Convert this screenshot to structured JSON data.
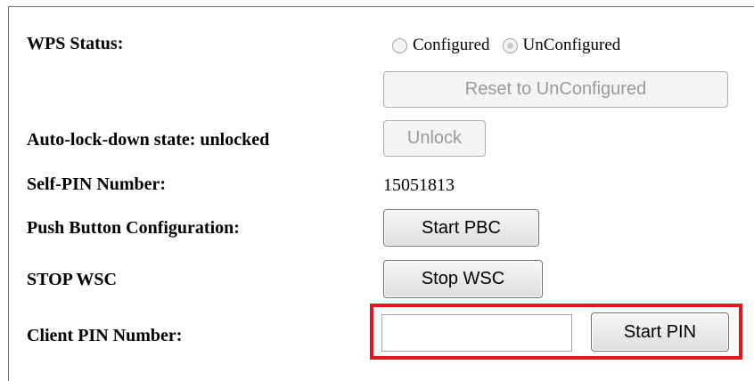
{
  "wps_status": {
    "label": "WPS Status:",
    "options": [
      {
        "label": "Configured",
        "checked": false
      },
      {
        "label": "UnConfigured",
        "checked": true
      }
    ],
    "reset_button": "Reset to UnConfigured"
  },
  "auto_lock": {
    "label": "Auto-lock-down state: unlocked",
    "unlock_button": "Unlock"
  },
  "self_pin": {
    "label": "Self-PIN Number:",
    "value": "15051813"
  },
  "pbc": {
    "label": "Push Button Configuration:",
    "button": "Start PBC"
  },
  "stop_wsc": {
    "label": "STOP WSC",
    "button": "Stop WSC"
  },
  "client_pin": {
    "label": "Client PIN Number:",
    "input_value": "",
    "button": "Start PIN"
  },
  "colors": {
    "highlight": "#e8141c"
  }
}
